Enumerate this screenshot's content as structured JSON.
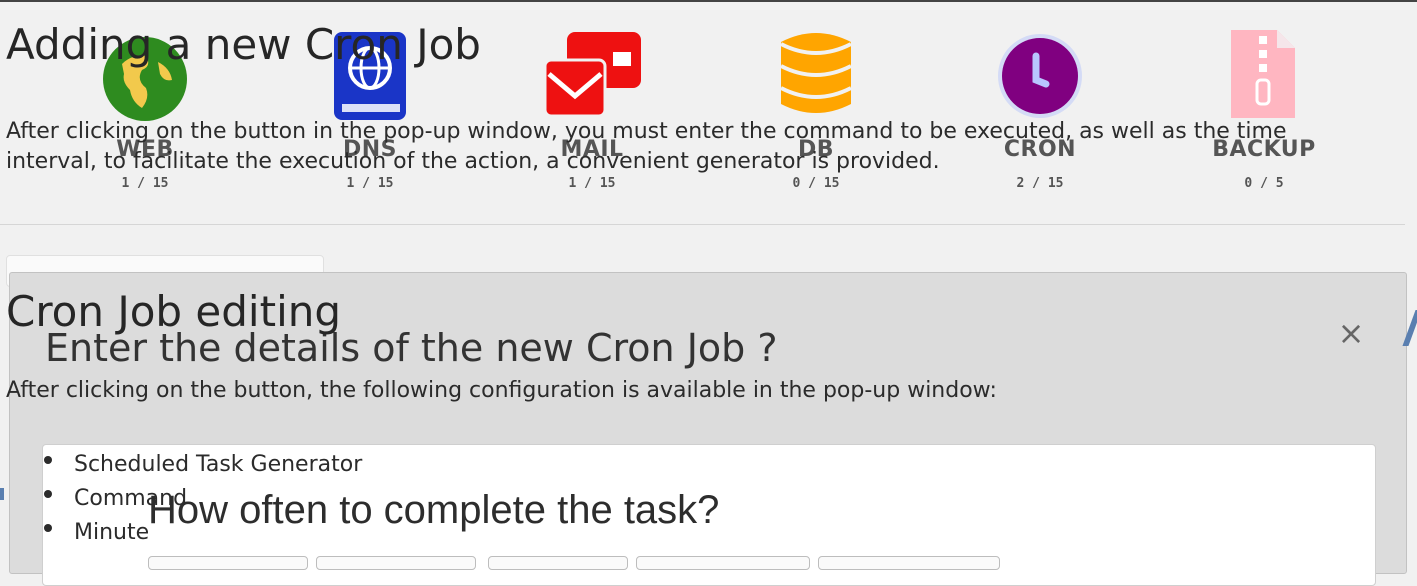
{
  "background_panel": {
    "services": [
      {
        "name": "WEB",
        "count": "1 / 15",
        "icon": "globe-icon",
        "color": "#2e8b1f"
      },
      {
        "name": "DNS",
        "count": "1 / 15",
        "icon": "dns-book-icon",
        "color": "#1a35c7"
      },
      {
        "name": "MAIL",
        "count": "1 / 15",
        "icon": "mail-icon",
        "color": "#ee1111"
      },
      {
        "name": "DB",
        "count": "0 / 15",
        "icon": "database-icon",
        "color": "#ffa500"
      },
      {
        "name": "CRON",
        "count": "2 / 15",
        "icon": "clock-icon",
        "color": "#800080"
      },
      {
        "name": "BACKUP",
        "count": "0 / 5",
        "icon": "zip-file-icon",
        "color": "#ffb6c1"
      }
    ]
  },
  "modal": {
    "title": "Enter the details of the new Cron Job ?",
    "close": "×",
    "question": "How often to complete the task?"
  },
  "doc": {
    "section1": {
      "heading": "Adding a new Cron Job",
      "paragraph": "After clicking on the button in the pop-up window, you must enter the command to be executed, as well as the time interval, to facilitate the execution of the action, a convenient generator is provided."
    },
    "section2": {
      "heading": "Cron Job editing",
      "paragraph": "After clicking on the button, the following configuration is available in the pop-up window:",
      "items": [
        "Scheduled Task Generator",
        "Command",
        "Minute"
      ]
    }
  }
}
